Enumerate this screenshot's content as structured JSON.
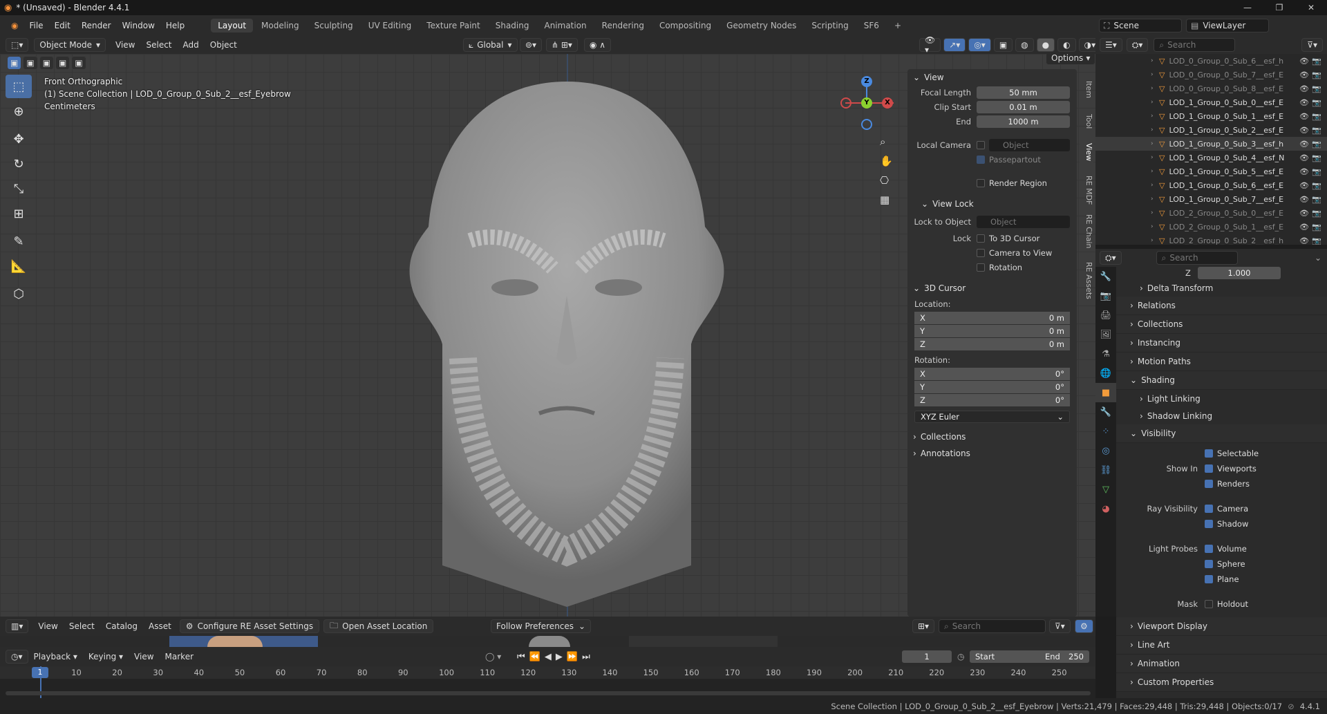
{
  "window": {
    "title": "* (Unsaved) - Blender 4.4.1",
    "buttons": [
      "—",
      "❐",
      "✕"
    ]
  },
  "menu": [
    "File",
    "Edit",
    "Render",
    "Window",
    "Help"
  ],
  "workspaces": [
    "Layout",
    "Modeling",
    "Sculpting",
    "UV Editing",
    "Texture Paint",
    "Shading",
    "Animation",
    "Rendering",
    "Compositing",
    "Geometry Nodes",
    "Scripting",
    "SF6"
  ],
  "active_workspace": "Layout",
  "scene": {
    "name": "Scene",
    "view_layer": "ViewLayer"
  },
  "viewport_header": {
    "mode": "Object Mode",
    "menus": [
      "View",
      "Select",
      "Add",
      "Object"
    ],
    "orientation": "Global",
    "options": "Options"
  },
  "viewport_info": {
    "line1": "Front Orthographic",
    "line2": "(1) Scene Collection | LOD_0_Group_0_Sub_2__esf_Eyebrow",
    "line3": "Centimeters"
  },
  "gizmo": {
    "z": "Z",
    "y": "Y",
    "x": "X"
  },
  "npanel": {
    "view_title": "View",
    "focal_label": "Focal Length",
    "focal": "50 mm",
    "clip_start_label": "Clip Start",
    "clip_start": "0.01 m",
    "end_label": "End",
    "end": "1000 m",
    "local_camera": "Local Camera",
    "object_placeholder": "Object",
    "passepartout": "Passepartout",
    "render_region": "Render Region",
    "view_lock_title": "View Lock",
    "lock_to_object": "Lock to Object",
    "lock": "Lock",
    "to_cursor": "To 3D Cursor",
    "cam_to_view": "Camera to View",
    "rotation_chk": "Rotation",
    "cursor_title": "3D Cursor",
    "location": "Location:",
    "loc": [
      {
        "a": "X",
        "v": "0 m"
      },
      {
        "a": "Y",
        "v": "0 m"
      },
      {
        "a": "Z",
        "v": "0 m"
      }
    ],
    "rotation": "Rotation:",
    "rot": [
      {
        "a": "X",
        "v": "0°"
      },
      {
        "a": "Y",
        "v": "0°"
      },
      {
        "a": "Z",
        "v": "0°"
      }
    ],
    "euler": "XYZ Euler",
    "collections": "Collections",
    "annotations": "Annotations"
  },
  "vtabs": [
    "Item",
    "Tool",
    "View",
    "RE MDF",
    "RE Chain",
    "RE Assets"
  ],
  "outliner": {
    "search": "Search",
    "rows": [
      {
        "name": "LOD_0_Group_0_Sub_6__esf_h",
        "dim": true
      },
      {
        "name": "LOD_0_Group_0_Sub_7__esf_E",
        "dim": true
      },
      {
        "name": "LOD_0_Group_0_Sub_8__esf_E",
        "dim": true
      },
      {
        "name": "LOD_1_Group_0_Sub_0__esf_E",
        "dim": false
      },
      {
        "name": "LOD_1_Group_0_Sub_1__esf_E",
        "dim": false
      },
      {
        "name": "LOD_1_Group_0_Sub_2__esf_E",
        "dim": false
      },
      {
        "name": "LOD_1_Group_0_Sub_3__esf_h",
        "dim": false,
        "sel": true
      },
      {
        "name": "LOD_1_Group_0_Sub_4__esf_N",
        "dim": false
      },
      {
        "name": "LOD_1_Group_0_Sub_5__esf_E",
        "dim": false
      },
      {
        "name": "LOD_1_Group_0_Sub_6__esf_E",
        "dim": false
      },
      {
        "name": "LOD_1_Group_0_Sub_7__esf_E",
        "dim": false
      },
      {
        "name": "LOD_2_Group_0_Sub_0__esf_E",
        "dim": true
      },
      {
        "name": "LOD_2_Group_0_Sub_1__esf_E",
        "dim": true
      },
      {
        "name": "LOD_2_Group_0_Sub_2__esf_h",
        "dim": true
      }
    ]
  },
  "properties": {
    "search": "Search",
    "z_label": "Z",
    "z_val": "1.000",
    "delta": "Delta Transform",
    "relations": "Relations",
    "collections": "Collections",
    "instancing": "Instancing",
    "motion_paths": "Motion Paths",
    "shading": "Shading",
    "light_linking": "Light Linking",
    "shadow_linking": "Shadow Linking",
    "visibility": "Visibility",
    "selectable": "Selectable",
    "show_in": "Show In",
    "viewports": "Viewports",
    "renders": "Renders",
    "ray_visibility": "Ray Visibility",
    "camera": "Camera",
    "shadow": "Shadow",
    "light_probes": "Light Probes",
    "volume": "Volume",
    "sphere": "Sphere",
    "plane": "Plane",
    "mask": "Mask",
    "holdout": "Holdout",
    "viewport_display": "Viewport Display",
    "line_art": "Line Art",
    "animation": "Animation",
    "custom_props": "Custom Properties"
  },
  "asset_bar": {
    "menus": [
      "View",
      "Select",
      "Catalog",
      "Asset"
    ],
    "configure": "Configure RE Asset Settings",
    "open_loc": "Open Asset Location",
    "follow": "Follow Preferences",
    "search": "Search"
  },
  "timeline": {
    "menus": [
      "Playback",
      "Keying",
      "View",
      "Marker"
    ],
    "current": "1",
    "start_label": "Start",
    "start": "1",
    "end_label": "End",
    "end": "250",
    "ticks": [
      "1",
      "10",
      "20",
      "30",
      "40",
      "50",
      "60",
      "70",
      "80",
      "90",
      "100",
      "110",
      "120",
      "130",
      "140",
      "150",
      "160",
      "170",
      "180",
      "190",
      "200",
      "210",
      "220",
      "230",
      "240",
      "250"
    ]
  },
  "status": "Scene Collection | LOD_0_Group_0_Sub_2__esf_Eyebrow | Verts:21,479 | Faces:29,448 | Tris:29,448 | Objects:0/17",
  "version": "4.4.1",
  "colors": {
    "accent": "#4772b3",
    "orange": "#f39c3b",
    "bg": "#3d3d3d"
  }
}
